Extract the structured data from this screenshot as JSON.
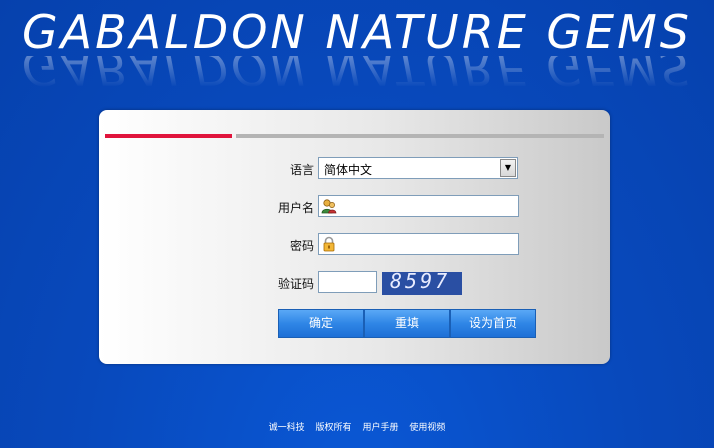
{
  "brand": {
    "title": "GABALDON NATURE GEMS"
  },
  "form": {
    "language_label": "语言",
    "language_value": "简体中文",
    "username_label": "用户名",
    "username_value": "",
    "password_label": "密码",
    "password_value": "",
    "captcha_label": "验证码",
    "captcha_value": "",
    "captcha_text": "8597",
    "icons": {
      "username": "user-icon",
      "password": "lock-icon"
    }
  },
  "buttons": {
    "confirm": "确定",
    "reset": "重填",
    "set_home": "设为首页"
  },
  "footer": {
    "links": [
      "诚一科技",
      "版权所有",
      "用户手册",
      "使用视频"
    ]
  },
  "colors": {
    "background": "#0849bc",
    "accent_red": "#e0143c",
    "button_blue": "#2f86e6"
  }
}
